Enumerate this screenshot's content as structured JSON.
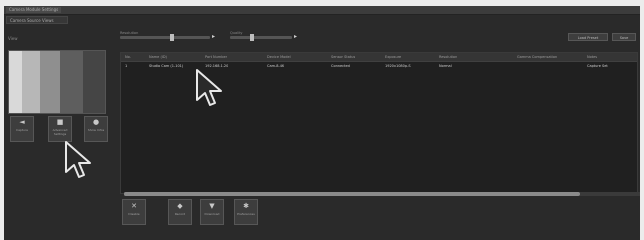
{
  "window": {
    "title": "Camera Module Settings",
    "tab": "Camera Source Views"
  },
  "preview": {
    "label": "View",
    "swatches": [
      "#d9d9d9",
      "#b7b7b7",
      "#8f8f8f",
      "#5e5e5e",
      "#454545"
    ]
  },
  "side_buttons": [
    {
      "label": "Capture",
      "icon": "capture-icon",
      "glyph": "◄"
    },
    {
      "label": "Advanced Settings",
      "icon": "advanced-icon",
      "glyph": "■"
    },
    {
      "label": "Show Infos",
      "icon": "info-icon",
      "glyph": "●"
    }
  ],
  "toolbar": {
    "left_label": "Resolution",
    "right_label": "Quality",
    "button_a": "Load Preset",
    "button_b": "Save"
  },
  "table": {
    "columns": [
      "No.",
      "Name (ID)",
      "Port Number",
      "Device Model",
      "Sensor Status",
      "Exposure",
      "Resolution",
      "Gamma Compensation",
      "Notes"
    ],
    "rows": [
      [
        "1",
        "Studio Cam (1-101)",
        "192.168.1.20",
        "Cam-8-4K",
        "Connected",
        "1920x1080p-S",
        "Normal",
        "",
        "Capture Set"
      ]
    ]
  },
  "bottom_buttons": [
    {
      "label": "Disable",
      "icon": "disable-icon",
      "glyph": "✕"
    },
    {
      "label": "Record",
      "icon": "record-icon",
      "glyph": "◆"
    },
    {
      "label": "Download",
      "icon": "download-icon",
      "glyph": "▼"
    },
    {
      "label": "Preferences",
      "icon": "preferences-icon",
      "glyph": "✱"
    }
  ]
}
